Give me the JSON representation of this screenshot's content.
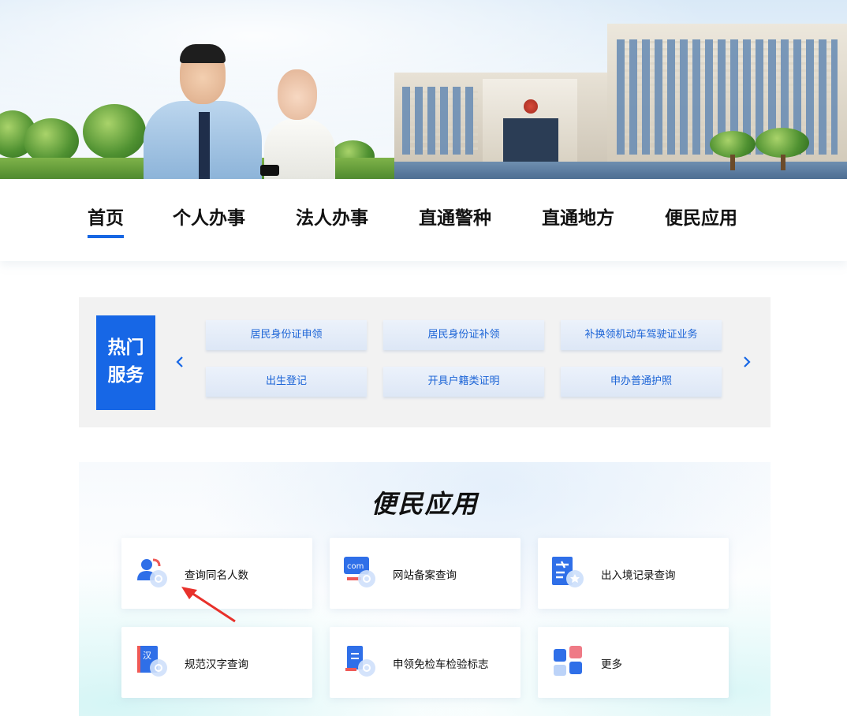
{
  "nav": {
    "items": [
      {
        "label": "首页",
        "active": true
      },
      {
        "label": "个人办事",
        "active": false
      },
      {
        "label": "法人办事",
        "active": false
      },
      {
        "label": "直通警种",
        "active": false
      },
      {
        "label": "直通地方",
        "active": false
      },
      {
        "label": "便民应用",
        "active": false
      }
    ],
    "accent_color": "#1766e3"
  },
  "hot_services": {
    "label_line1": "热门",
    "label_line2": "服务",
    "prev_icon": "chevron-left-icon",
    "next_icon": "chevron-right-icon",
    "items": [
      "居民身份证申领",
      "居民身份证补领",
      "补换领机动车驾驶证业务",
      "出生登记",
      "开具户籍类证明",
      "申办普通护照"
    ],
    "label_bg": "#1767e6"
  },
  "convenience": {
    "title": "便民应用",
    "cards": [
      {
        "label": "查询同名人数",
        "icon": "people-search-icon"
      },
      {
        "label": "网站备案查询",
        "icon": "website-com-icon"
      },
      {
        "label": "出入境记录查询",
        "icon": "airplane-record-icon"
      },
      {
        "label": "规范汉字查询",
        "icon": "chinese-book-icon"
      },
      {
        "label": "申领免检车检验标志",
        "icon": "vehicle-document-icon"
      },
      {
        "label": "更多",
        "icon": "grid-more-icon"
      }
    ]
  },
  "annotation": {
    "icon": "red-arrow-icon",
    "color": "#e8312b"
  }
}
